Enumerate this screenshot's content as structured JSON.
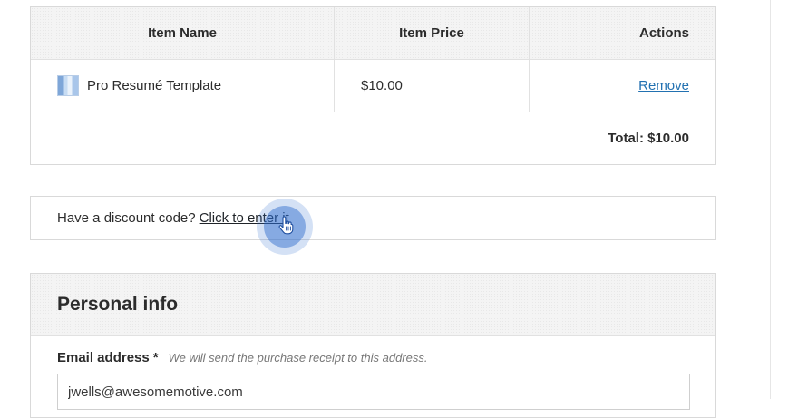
{
  "cart": {
    "headers": {
      "name": "Item Name",
      "price": "Item Price",
      "actions": "Actions"
    },
    "items": [
      {
        "name": "Pro Resumé Template",
        "price": "$10.00",
        "action_label": "Remove",
        "thumbnail_icon": "template-thumbnail-icon"
      }
    ],
    "total": "Total: $10.00"
  },
  "discount": {
    "prompt": "Have a discount code?",
    "link_label": "Click to enter it"
  },
  "click_indicator": {
    "icon": "hand-pointer-icon",
    "color": "#3c78d2"
  },
  "personal_info": {
    "title": "Personal info",
    "email_label": "Email address",
    "required_mark": "*",
    "email_help": "We will send the purchase receipt to this address.",
    "email_value": "jwells@awesomemotive.com"
  },
  "colors": {
    "link": "#2271b1",
    "border": "#d9d9d9",
    "header_bg": "#f4f4f4"
  }
}
